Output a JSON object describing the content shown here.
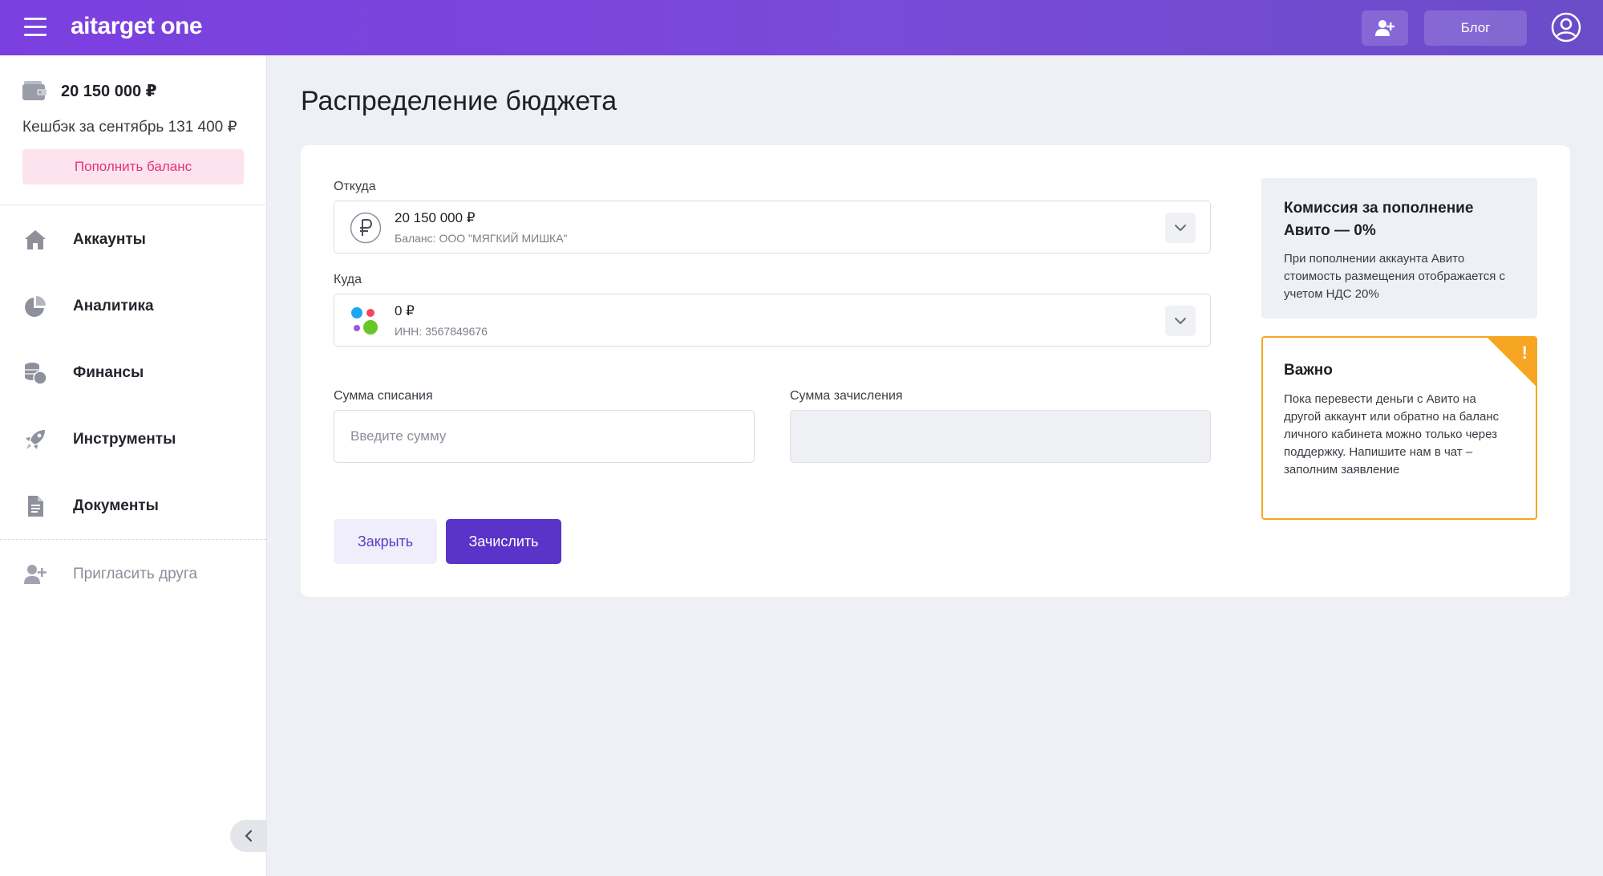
{
  "header": {
    "logo": "aitarget one",
    "blog_label": "Блог"
  },
  "sidebar": {
    "balance": "20 150 000 ₽",
    "cashback": "Кешбэк за сентябрь 131 400 ₽",
    "topup_label": "Пополнить баланс",
    "items": [
      {
        "label": "Аккаунты",
        "icon": "home-icon"
      },
      {
        "label": "Аналитика",
        "icon": "pie-chart-icon"
      },
      {
        "label": "Финансы",
        "icon": "coins-icon"
      },
      {
        "label": "Инструменты",
        "icon": "rocket-icon"
      },
      {
        "label": "Документы",
        "icon": "document-icon"
      }
    ],
    "invite_label": "Пригласить друга"
  },
  "main": {
    "title": "Распределение бюджета",
    "from": {
      "label": "Откуда",
      "amount": "20 150 000 ₽",
      "sub": "Баланс: ООО \"МЯГКИЙ МИШКА\""
    },
    "to": {
      "label": "Куда",
      "amount": "0 ₽",
      "sub": "ИНН: 3567849676"
    },
    "debit": {
      "label": "Сумма списания",
      "placeholder": "Введите сумму",
      "value": ""
    },
    "credit": {
      "label": "Сумма зачисления",
      "value": ""
    },
    "close_label": "Закрыть",
    "submit_label": "Зачислить"
  },
  "info": {
    "title": "Комиссия за пополнение Авито — 0%",
    "text": "При пополнении аккаунта Авито стоимость размещения отображается с учетом НДС 20%"
  },
  "warning": {
    "title": "Важно",
    "text": "Пока перевести деньги с Авито на другой аккаунт или обратно на баланс личного кабинета можно только через поддержку. Напишите нам в чат – заполним заявление",
    "badge": "!"
  },
  "colors": {
    "brand": "#7b3fe0",
    "primary_button": "#5a33c8",
    "topup_text": "#e3347a",
    "warning": "#f6a623"
  }
}
